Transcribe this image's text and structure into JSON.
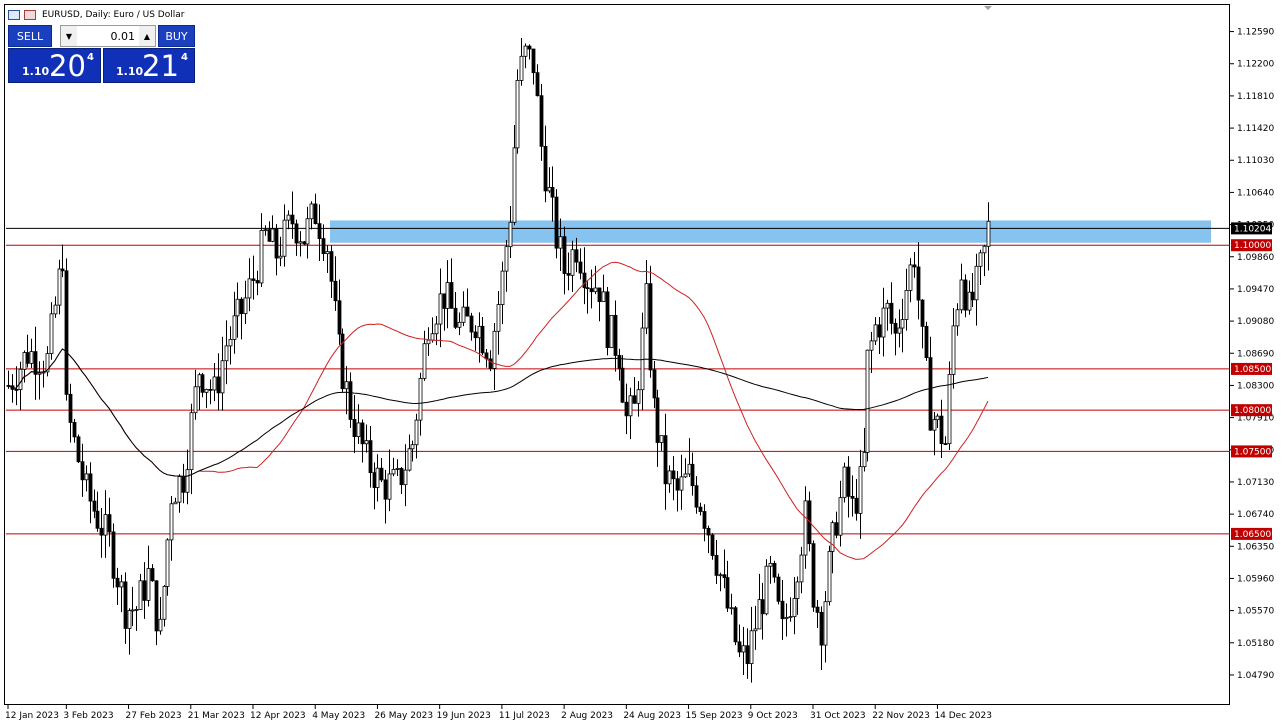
{
  "window": {
    "title": "EURUSD, Daily:  Euro / US Dollar",
    "icons": [
      "chart-window-icon",
      "template-icon"
    ]
  },
  "trade_panel": {
    "sell_label": "SELL",
    "buy_label": "BUY",
    "lot_value": "0.01",
    "sell_price": {
      "small": "1.10",
      "big": "20",
      "sup": "4"
    },
    "buy_price": {
      "small": "1.10",
      "big": "21",
      "sup": "4"
    },
    "down_arrow": "▼",
    "up_arrow": "▲"
  },
  "colors": {
    "bull_fill": "#ffffff",
    "bear_fill": "#000000",
    "candle_stroke": "#000000",
    "ma_fast": "#d02020",
    "ma_slow": "#000000",
    "level_line": "#c00000",
    "zone_fill": "#87c3f0",
    "tag_red": "#c00000",
    "tag_black": "#000000"
  },
  "chart_data": {
    "type": "candlestick",
    "symbol": "EURUSD",
    "timeframe": "Daily",
    "ylim": [
      1.0445,
      1.129
    ],
    "y_ticks": [
      "1.12590",
      "1.12200",
      "1.11810",
      "1.11420",
      "1.11030",
      "1.10640",
      "1.10250",
      "1.09860",
      "1.09470",
      "1.09080",
      "1.08690",
      "1.08300",
      "1.07910",
      "1.07520",
      "1.07130",
      "1.06740",
      "1.06350",
      "1.05960",
      "1.05570",
      "1.05180",
      "1.04790"
    ],
    "x_labels": [
      "12 Jan 2023",
      "3 Feb 2023",
      "27 Feb 2023",
      "21 Mar 2023",
      "12 Apr 2023",
      "4 May 2023",
      "26 May 2023",
      "19 Jun 2023",
      "11 Jul 2023",
      "2 Aug 2023",
      "24 Aug 2023",
      "15 Sep 2023",
      "9 Oct 2023",
      "31 Oct 2023",
      "22 Nov 2023",
      "14 Dec 2023"
    ],
    "x_label_bar_index": [
      0,
      15,
      31,
      47,
      63,
      79,
      95,
      111,
      127,
      143,
      159,
      175,
      191,
      207,
      223,
      239
    ],
    "horizontal_levels": [
      {
        "value": 1.1,
        "label": "1.10000"
      },
      {
        "value": 1.085,
        "label": "1.08500"
      },
      {
        "value": 1.08,
        "label": "1.08000"
      },
      {
        "value": 1.075,
        "label": "1.07500"
      },
      {
        "value": 1.065,
        "label": "1.06500"
      }
    ],
    "current_price": {
      "value": 1.10204,
      "label": "1.10204"
    },
    "resistance_zone": {
      "low": 1.1003,
      "high": 1.103
    },
    "ma_fast_label": "",
    "ma_slow_label": "",
    "anchors": [
      [
        0,
        1.083
      ],
      [
        5,
        1.087
      ],
      [
        10,
        1.086
      ],
      [
        14,
        1.099
      ],
      [
        15,
        1.08
      ],
      [
        20,
        1.07
      ],
      [
        26,
        1.064
      ],
      [
        30,
        1.056
      ],
      [
        33,
        1.056
      ],
      [
        36,
        1.06
      ],
      [
        39,
        1.053
      ],
      [
        42,
        1.07
      ],
      [
        45,
        1.072
      ],
      [
        49,
        1.085
      ],
      [
        53,
        1.082
      ],
      [
        56,
        1.088
      ],
      [
        60,
        1.092
      ],
      [
        63,
        1.096
      ],
      [
        66,
        1.101
      ],
      [
        69,
        1.099
      ],
      [
        73,
        1.103
      ],
      [
        76,
        1.101
      ],
      [
        79,
        1.104
      ],
      [
        82,
        1.1
      ],
      [
        85,
        1.087
      ],
      [
        88,
        1.08
      ],
      [
        92,
        1.074
      ],
      [
        96,
        1.071
      ],
      [
        100,
        1.071
      ],
      [
        104,
        1.076
      ],
      [
        108,
        1.091
      ],
      [
        112,
        1.094
      ],
      [
        116,
        1.09
      ],
      [
        120,
        1.091
      ],
      [
        124,
        1.087
      ],
      [
        127,
        1.096
      ],
      [
        129,
        1.104
      ],
      [
        131,
        1.12
      ],
      [
        133,
        1.123
      ],
      [
        135,
        1.122
      ],
      [
        137,
        1.112
      ],
      [
        139,
        1.106
      ],
      [
        141,
        1.101
      ],
      [
        143,
        1.097
      ],
      [
        146,
        1.1
      ],
      [
        149,
        1.096
      ],
      [
        152,
        1.095
      ],
      [
        154,
        1.09
      ],
      [
        157,
        1.087
      ],
      [
        159,
        1.079
      ],
      [
        161,
        1.08
      ],
      [
        164,
        1.093
      ],
      [
        166,
        1.08
      ],
      [
        169,
        1.072
      ],
      [
        172,
        1.07
      ],
      [
        175,
        1.072
      ],
      [
        178,
        1.069
      ],
      [
        181,
        1.064
      ],
      [
        185,
        1.056
      ],
      [
        188,
        1.05
      ],
      [
        190,
        1.05
      ],
      [
        193,
        1.056
      ],
      [
        196,
        1.06
      ],
      [
        199,
        1.053
      ],
      [
        202,
        1.059
      ],
      [
        205,
        1.067
      ],
      [
        207,
        1.058
      ],
      [
        209,
        1.054
      ],
      [
        211,
        1.061
      ],
      [
        213,
        1.067
      ],
      [
        215,
        1.071
      ],
      [
        217,
        1.068
      ],
      [
        219,
        1.071
      ],
      [
        220,
        1.074
      ],
      [
        221,
        1.086
      ],
      [
        223,
        1.09
      ],
      [
        226,
        1.092
      ],
      [
        228,
        1.089
      ],
      [
        231,
        1.095
      ],
      [
        233,
        1.099
      ],
      [
        235,
        1.088
      ],
      [
        237,
        1.08
      ],
      [
        239,
        1.078
      ],
      [
        241,
        1.076
      ],
      [
        243,
        1.09
      ],
      [
        245,
        1.097
      ],
      [
        247,
        1.092
      ],
      [
        249,
        1.095
      ],
      [
        251,
        1.099
      ],
      [
        252,
        1.102
      ]
    ]
  }
}
